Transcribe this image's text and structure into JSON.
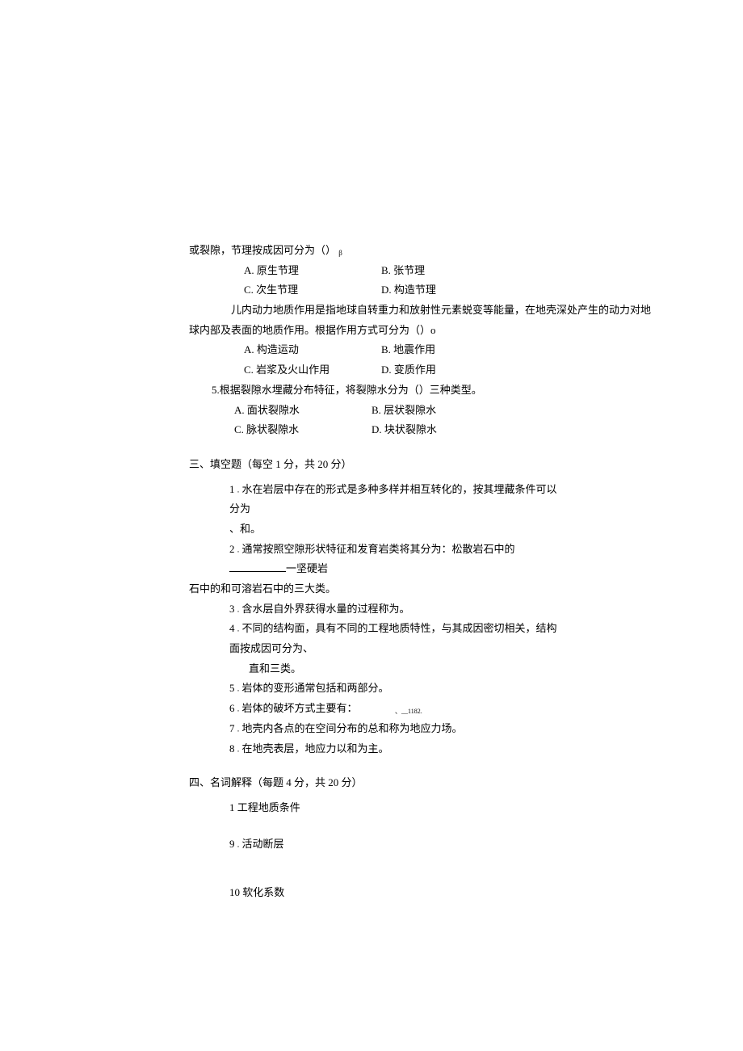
{
  "intro_line": "或裂隙，节理按成因可分为（） ",
  "intro_sub": "β",
  "q3": {
    "A": "A. 原生节理",
    "B": "B. 张节理",
    "C": "C. 次生节理",
    "D": "D. 构造节理"
  },
  "q4_pre": "儿内动力地质作用是指地球自转重力和放射性元素蜕变等能量，在地壳深处产生的动力对地",
  "q4_cont": "球内部及表面的地质作用。根据作用方式可分为（）o",
  "q4": {
    "A": "A. 构造运动",
    "B": "B. 地震作用",
    "C": "C. 岩浆及火山作用",
    "D": "D. 变质作用"
  },
  "q5_stem": "5.根据裂隙水埋藏分布特征，将裂隙水分为（）三种类型。",
  "q5": {
    "A": "A. 面状裂隙水",
    "B": "B. 层状裂隙水",
    "C": "C. 脉状裂隙水",
    "D": "D. 块状裂隙水"
  },
  "section3_header": "三、填空题（每空 1 分，共 20 分）",
  "fill": {
    "q1": "1 ",
    "q1_dot": ".",
    "q1_text": "水在岩层中存在的形式是多种多样并相互转化的，按其埋藏条件可以分为",
    "q1_cont": "、和。",
    "q2": "2 ",
    "q2_dot": ".",
    "q2_text_a": "通常按照空隙形状特征和发育岩类将其分为：松散岩石中的 ",
    "q2_text_b": "一坚硬岩",
    "q2_cont": "石中的和可溶岩石中的三大类。",
    "q3": "3 ",
    "q3_dot": ".",
    "q3_text": " 含水层自外界获得水量的过程称为。",
    "q4": "4 ",
    "q4_dot": ".",
    "q4_text": "不同的结构面，具有不同的工程地质特性，与其成因密切相关，结构面按成因可分为、",
    "q4_cont": "直和三类。",
    "q5": "5 ",
    "q5_dot": ".",
    "q5_text": " 岩体的变形通常包括和两部分。",
    "q6": "6 ",
    "q6_dot": ".",
    "q6_text": "岩体的破坏方式主要有：",
    "q6_sub": "、__1182.",
    "q7": "7 ",
    "q7_dot": ".",
    "q7_text": " 地壳内各点的在空间分布的总和称为地应力场。",
    "q8": "8 ",
    "q8_dot": ".",
    "q8_text": " 在地壳表层，地应力以和为主。"
  },
  "section4_header": "四、名词解释（每题 4 分，共 20 分）",
  "term": {
    "q1": "1 工程地质条件",
    "q9": "9 ",
    "q9_dot": ".",
    "q9_text": " 活动断层",
    "q10": "10  软化系数"
  }
}
